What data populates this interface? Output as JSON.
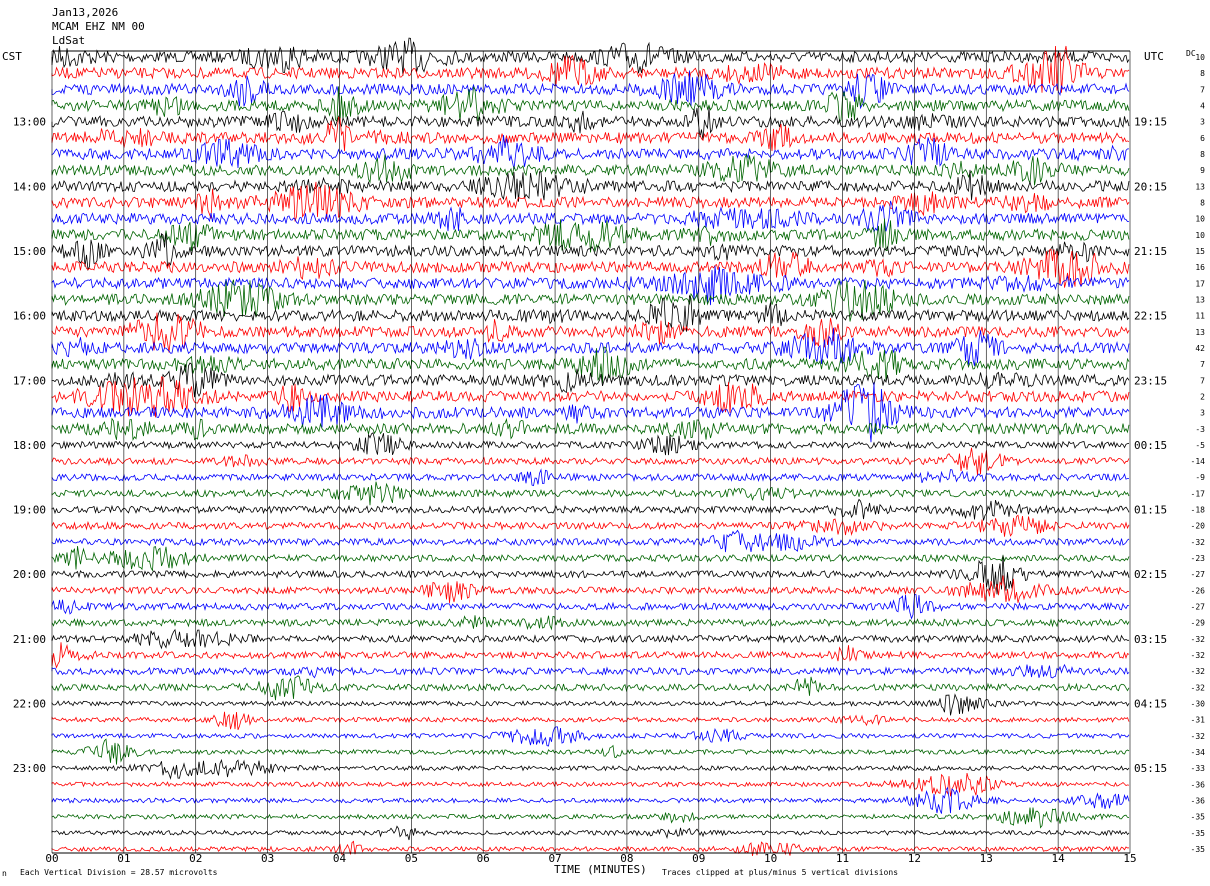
{
  "header": {
    "date": "Jan13,2026",
    "station": "MCAM EHZ NM 00",
    "note": "LdSat"
  },
  "colors": {
    "series": [
      "#000000",
      "#ff0000",
      "#0000ff",
      "#006400"
    ]
  },
  "chart_data": {
    "type": "helicorder",
    "xlabel": "TIME (MINUTES)",
    "xlim": [
      0,
      15
    ],
    "x_ticks": [
      "00",
      "01",
      "02",
      "03",
      "04",
      "05",
      "06",
      "07",
      "08",
      "09",
      "10",
      "11",
      "12",
      "13",
      "14",
      "15"
    ],
    "left_label": "CST",
    "right_label": "UTC",
    "dc_label": "DC",
    "left_hours": [
      "13:00",
      "14:00",
      "15:00",
      "16:00",
      "17:00",
      "18:00",
      "19:00",
      "20:00",
      "21:00",
      "22:00",
      "23:00"
    ],
    "right_hours": [
      "19:15",
      "20:15",
      "21:15",
      "22:15",
      "23:15",
      "00:15",
      "01:15",
      "02:15",
      "03:15",
      "04:15",
      "05:15"
    ],
    "dc_offsets": [
      "10",
      "8",
      "7",
      "4",
      "3",
      "6",
      "8",
      "9",
      "13",
      "8",
      "10",
      "10",
      "15",
      "16",
      "17",
      "13",
      "11",
      "13",
      "42",
      "7",
      "7",
      "2",
      "3",
      "-3",
      "-5",
      "-14",
      "-9",
      "-17",
      "-18",
      "-20",
      "-32",
      "-23",
      "-27",
      "-26",
      "-27",
      "-29",
      "-32",
      "-32",
      "-32",
      "-32",
      "-30",
      "-31",
      "-32",
      "-34",
      "-33",
      "-36",
      "-36",
      "-35",
      "-35",
      "-35"
    ],
    "footer_left": "Each Vertical Division =   28.57 microvolts",
    "footer_right": "Traces clipped at plus/minus 5 vertical divisions",
    "corner_mark": "n"
  }
}
